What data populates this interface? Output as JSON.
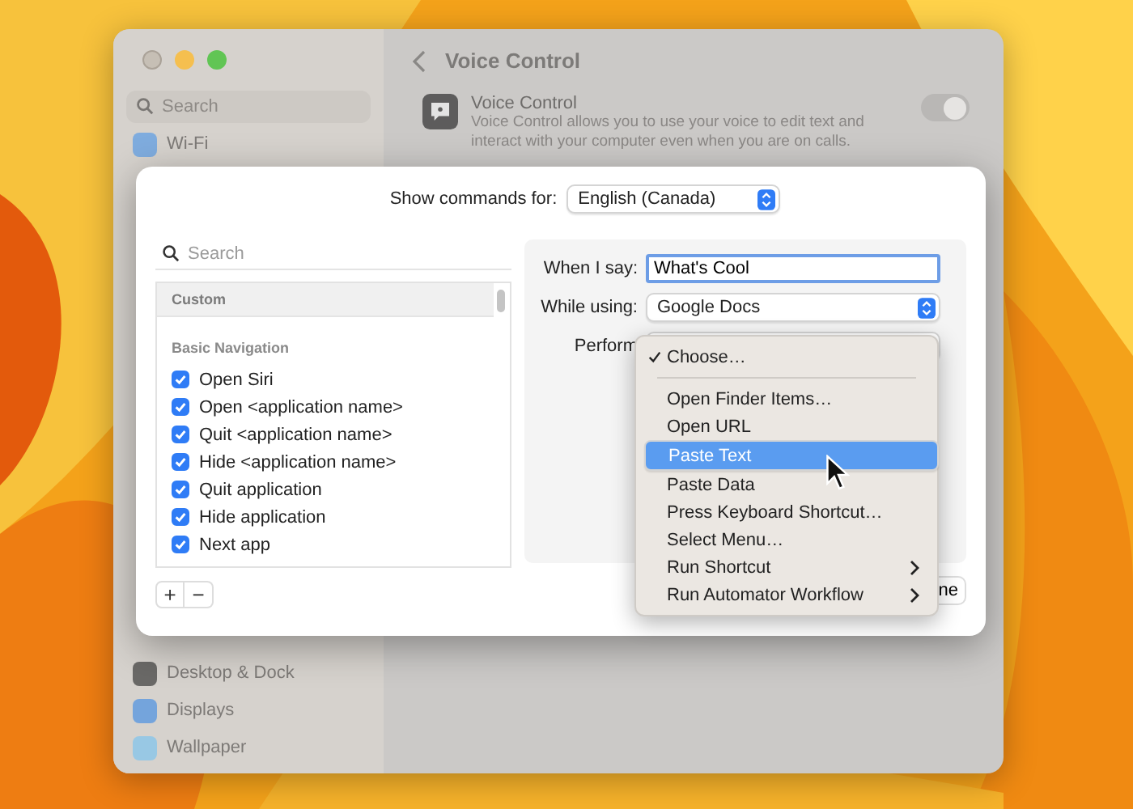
{
  "sidebar": {
    "search_placeholder": "Search",
    "top_items": [
      {
        "label": "Wi-Fi",
        "kind": "wifi"
      }
    ],
    "bottom_items": [
      {
        "label": "Desktop & Dock",
        "kind": "dock"
      },
      {
        "label": "Displays",
        "kind": "displays"
      },
      {
        "label": "Wallpaper",
        "kind": "wallpaper"
      }
    ]
  },
  "header": {
    "title": "Voice Control"
  },
  "voice_control": {
    "title": "Voice Control",
    "description": "Voice Control allows you to use your voice to edit text and interact with your computer even when you are on calls.",
    "on": true
  },
  "sheet": {
    "show_commands_label": "Show commands for:",
    "language": "English (Canada)",
    "search_placeholder": "Search",
    "list": [
      {
        "kind": "group",
        "label": "Custom"
      },
      {
        "kind": "section",
        "label": "Basic Navigation"
      },
      {
        "kind": "command",
        "label": "Open Siri",
        "checked": true
      },
      {
        "kind": "command",
        "label": "Open <application name>",
        "checked": true
      },
      {
        "kind": "command",
        "label": "Quit <application name>",
        "checked": true
      },
      {
        "kind": "command",
        "label": "Hide <application name>",
        "checked": true
      },
      {
        "kind": "command",
        "label": "Quit application",
        "checked": true
      },
      {
        "kind": "command",
        "label": "Hide application",
        "checked": true
      },
      {
        "kind": "command",
        "label": "Next app",
        "checked": true
      }
    ],
    "add_button": "+",
    "remove_button": "−",
    "form": {
      "when_label": "When I say:",
      "when_value": "What's Cool",
      "while_label": "While using:",
      "while_value": "Google Docs",
      "perform_label": "Perform"
    },
    "done_button": "ne"
  },
  "menu": {
    "items": [
      {
        "kind": "item",
        "label": "Choose…",
        "checked": true,
        "selected": false,
        "submenu": false
      },
      {
        "kind": "separator"
      },
      {
        "kind": "item",
        "label": "Open Finder Items…",
        "checked": false,
        "selected": false,
        "submenu": false
      },
      {
        "kind": "item",
        "label": "Open URL",
        "checked": false,
        "selected": false,
        "submenu": false
      },
      {
        "kind": "item",
        "label": "Paste Text",
        "checked": false,
        "selected": true,
        "submenu": false
      },
      {
        "kind": "item",
        "label": "Paste Data",
        "checked": false,
        "selected": false,
        "submenu": false
      },
      {
        "kind": "item",
        "label": "Press Keyboard Shortcut…",
        "checked": false,
        "selected": false,
        "submenu": false
      },
      {
        "kind": "item",
        "label": "Select Menu…",
        "checked": false,
        "selected": false,
        "submenu": false
      },
      {
        "kind": "item",
        "label": "Run Shortcut",
        "checked": false,
        "selected": false,
        "submenu": true
      },
      {
        "kind": "item",
        "label": "Run Automator Workflow",
        "checked": false,
        "selected": false,
        "submenu": true
      }
    ]
  }
}
